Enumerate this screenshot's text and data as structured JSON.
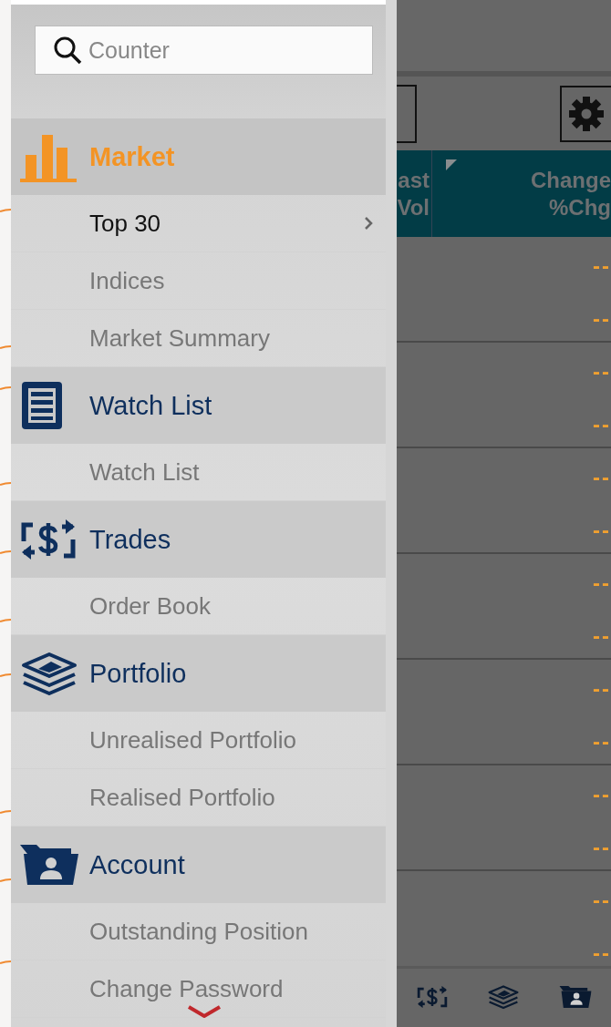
{
  "search": {
    "placeholder": "Counter"
  },
  "menu": [
    {
      "title": "Market",
      "kind": "chart",
      "active": true,
      "items": [
        {
          "label": "Top 30",
          "selected": true,
          "has_arrow": true
        },
        {
          "label": "Indices",
          "selected": false,
          "has_arrow": false
        },
        {
          "label": "Market Summary",
          "selected": false,
          "has_arrow": false
        }
      ]
    },
    {
      "title": "Watch List",
      "kind": "list",
      "active": false,
      "items": [
        {
          "label": "Watch List",
          "selected": false,
          "has_arrow": false
        }
      ]
    },
    {
      "title": "Trades",
      "kind": "exchange",
      "active": false,
      "items": [
        {
          "label": "Order Book",
          "selected": false,
          "has_arrow": false
        }
      ]
    },
    {
      "title": "Portfolio",
      "kind": "layers",
      "active": false,
      "items": [
        {
          "label": "Unrealised Portfolio",
          "selected": false,
          "has_arrow": false
        },
        {
          "label": "Realised Portfolio",
          "selected": false,
          "has_arrow": false
        }
      ]
    },
    {
      "title": "Account",
      "kind": "folder",
      "active": false,
      "items": [
        {
          "label": "Outstanding Position",
          "selected": false,
          "has_arrow": false
        },
        {
          "label": "Change Password",
          "selected": false,
          "has_arrow": false
        }
      ]
    }
  ],
  "table": {
    "columns": [
      {
        "label": "ast",
        "sub": "Vol"
      },
      {
        "label": "Change",
        "sub": "%Chg",
        "sort_marker": true
      }
    ],
    "rows": [
      {
        "value_1": "--",
        "value_2": "--"
      },
      {
        "value_1": "--",
        "value_2": "--"
      },
      {
        "value_1": "--",
        "value_2": "--"
      },
      {
        "value_1": "--",
        "value_2": "--"
      },
      {
        "value_1": "--",
        "value_2": "--"
      },
      {
        "value_1": "--",
        "value_2": "--"
      },
      {
        "value_1": "--",
        "value_2": "--"
      }
    ]
  },
  "bottom_nav": [
    {
      "kind": "exchange"
    },
    {
      "kind": "layers"
    },
    {
      "kind": "folder"
    }
  ]
}
